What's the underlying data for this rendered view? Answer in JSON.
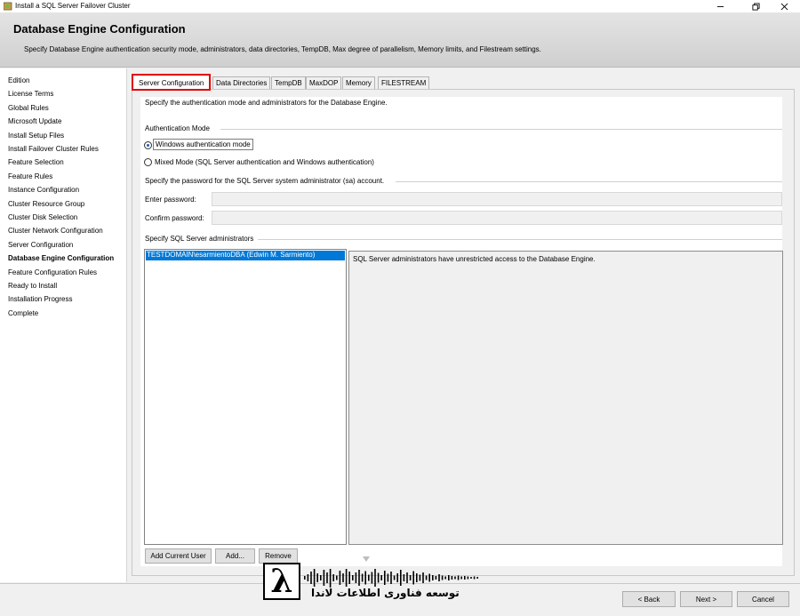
{
  "window": {
    "title": "Install a SQL Server Failover Cluster"
  },
  "header": {
    "title": "Database Engine Configuration",
    "description": "Specify Database Engine authentication security mode, administrators, data directories, TempDB, Max degree of parallelism, Memory limits, and Filestream settings."
  },
  "nav": {
    "items": [
      "Edition",
      "License Terms",
      "Global Rules",
      "Microsoft Update",
      "Install Setup Files",
      "Install Failover Cluster Rules",
      "Feature Selection",
      "Feature Rules",
      "Instance Configuration",
      "Cluster Resource Group",
      "Cluster Disk Selection",
      "Cluster Network Configuration",
      "Server Configuration",
      "Database Engine Configuration",
      "Feature Configuration Rules",
      "Ready to Install",
      "Installation Progress",
      "Complete"
    ],
    "active_index": 13
  },
  "tabs": [
    "Server Configuration",
    "Data Directories",
    "TempDB",
    "MaxDOP",
    "Memory",
    "FILESTREAM"
  ],
  "panel": {
    "intro": "Specify the authentication mode and administrators for the Database Engine.",
    "auth_group": "Authentication Mode",
    "radio_windows": "Windows authentication mode",
    "radio_mixed": "Mixed Mode (SQL Server authentication and Windows authentication)",
    "sa_group": "Specify the password for the SQL Server system administrator (sa) account.",
    "enter_password": "Enter password:",
    "confirm_password": "Confirm password:",
    "admins_group": "Specify SQL Server administrators",
    "admin_entry": "TESTDOMAIN\\esarmientoDBA (Edwin M. Sarmiento)",
    "admins_info": "SQL Server administrators have unrestricted access to the Database Engine.",
    "btn_add_current": "Add Current User",
    "btn_add": "Add...",
    "btn_remove": "Remove"
  },
  "footer": {
    "back_label": "< Back",
    "next_label": "Next >",
    "cancel_label": "Cancel"
  },
  "watermark": {
    "symbol": "λ",
    "text": "توسعه فناوری اطلاعات لاندا"
  },
  "colors": {
    "selection": "#0078d7",
    "highlight_border": "#e00000"
  }
}
